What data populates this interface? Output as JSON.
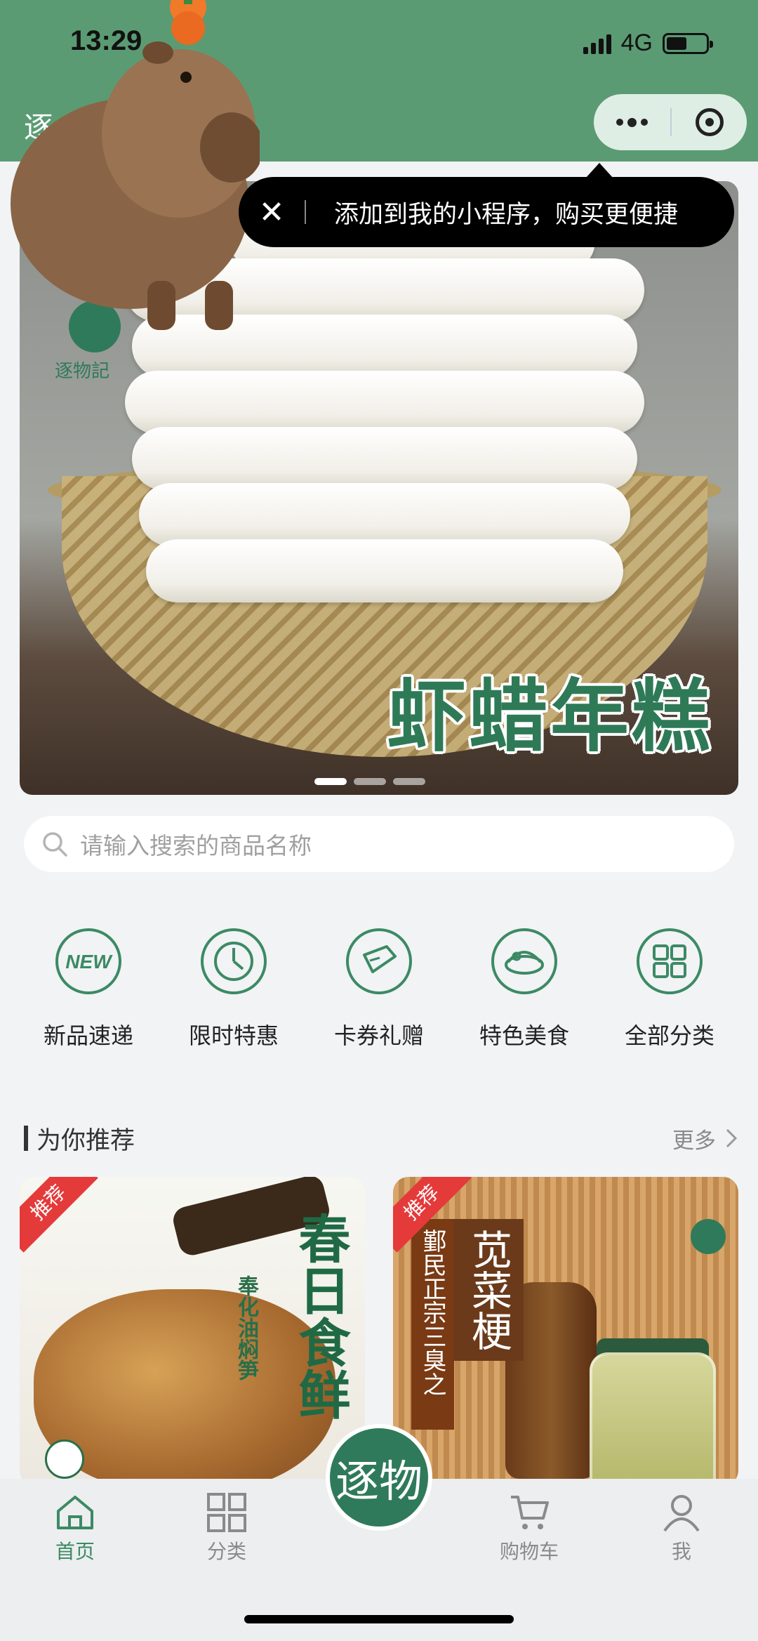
{
  "status_bar": {
    "time": "13:29",
    "network": "4G"
  },
  "header": {
    "title_hint": "逐",
    "bg_color": "#5b9b73"
  },
  "capsule": {
    "more_icon": "more-dots-icon",
    "close_icon": "target-close-icon"
  },
  "tooltip": {
    "close": "✕",
    "text": "添加到我的小程序，购买更便捷"
  },
  "banner": {
    "title": "虾蜡年糕",
    "brand": "逐物記",
    "slide_count": 3
  },
  "search": {
    "placeholder": "请输入搜索的商品名称"
  },
  "categories": [
    {
      "label": "新品速递",
      "icon": "new-icon"
    },
    {
      "label": "限时特惠",
      "icon": "clock-icon"
    },
    {
      "label": "卡券礼赠",
      "icon": "ticket-icon"
    },
    {
      "label": "特色美食",
      "icon": "dish-icon"
    },
    {
      "label": "全部分类",
      "icon": "grid-icon"
    }
  ],
  "recommend": {
    "title": "为你推荐",
    "more": "更多",
    "products": [
      {
        "badge": "推荐",
        "big_text": "春日食鲜",
        "small_text": "奉化油焖笋"
      },
      {
        "badge": "推荐",
        "title": "苋菜梗",
        "subtitle": "鄞民正宗三臭之"
      }
    ]
  },
  "tabbar": {
    "items": [
      {
        "label": "首页",
        "icon": "home-icon",
        "active": true
      },
      {
        "label": "分类",
        "icon": "category-grid-icon",
        "active": false
      },
      {
        "label": "购物车",
        "icon": "cart-icon",
        "active": false
      },
      {
        "label": "我",
        "icon": "user-icon",
        "active": false
      }
    ],
    "center_glyph": "逐物",
    "accent": "#3c8a64"
  }
}
